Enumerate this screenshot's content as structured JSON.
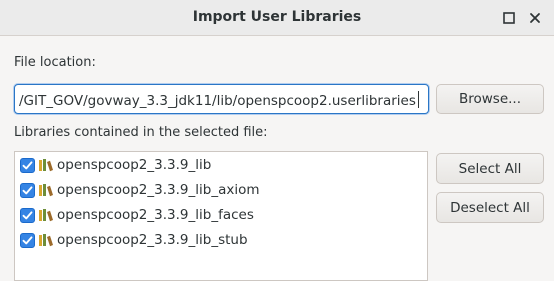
{
  "window": {
    "title": "Import User Libraries",
    "buttons": [
      "restore-icon",
      "close-icon"
    ]
  },
  "file_location": {
    "label": "File location:",
    "value": "/GIT_GOV/govway_3.3_jdk11/lib/openspcoop2.userlibraries",
    "browse_label": "Browse..."
  },
  "libraries": {
    "label": "Libraries contained in the selected file:",
    "items": [
      {
        "name": "openspcoop2_3.3.9_lib",
        "checked": true
      },
      {
        "name": "openspcoop2_3.3.9_lib_axiom",
        "checked": true
      },
      {
        "name": "openspcoop2_3.3.9_lib_faces",
        "checked": true
      },
      {
        "name": "openspcoop2_3.3.9_lib_stub",
        "checked": true
      }
    ],
    "select_all_label": "Select All",
    "deselect_all_label": "Deselect All"
  },
  "colors": {
    "accent": "#3584e4",
    "focus_border": "#2a76c6",
    "window_bg": "#f6f5f4"
  }
}
